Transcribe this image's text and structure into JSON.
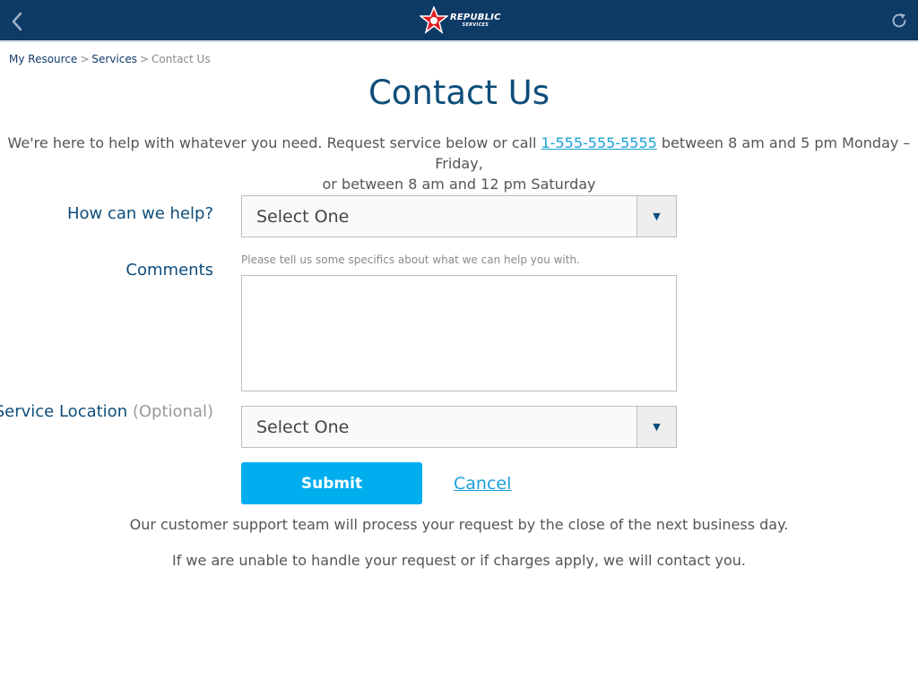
{
  "header": {
    "logo_line1": "REPUBLIC",
    "logo_line2": "SERVICES",
    "brand_color": "#0e3a66",
    "accent_color": "#e31b23"
  },
  "breadcrumb": {
    "items": [
      "My Resource",
      "Services",
      "Contact Us"
    ],
    "separator": ">"
  },
  "page": {
    "title": "Contact Us",
    "intro_before": "We're here to help with whatever you need. Request service below or call ",
    "phone": "1-555-555-5555",
    "intro_after_line1": " between 8 am and 5 pm Monday – Friday,",
    "intro_line2": "or between 8 am and 12 pm Saturday"
  },
  "form": {
    "help_label": "How can we help?",
    "help_select_value": "Select One",
    "comments_label": "Comments",
    "comments_hint": "Please tell us some specifics about what we can help you with.",
    "comments_value": "",
    "location_label": "Service Location",
    "location_optional": "(Optional)",
    "location_select_value": "Select One",
    "submit_label": "Submit",
    "cancel_label": "Cancel"
  },
  "notes": {
    "line1": "Our customer support team will process your request by the close of the next business day.",
    "line2": "If we are unable to handle your request or if charges apply, we will contact you."
  },
  "icons": {
    "back": "chevron-left-icon",
    "refresh": "refresh-icon",
    "dropdown": "triangle-down-icon",
    "logo": "star-logo-icon"
  },
  "colors": {
    "link": "#1ba0d7",
    "submit": "#00aeef",
    "title": "#0e4d7a"
  }
}
